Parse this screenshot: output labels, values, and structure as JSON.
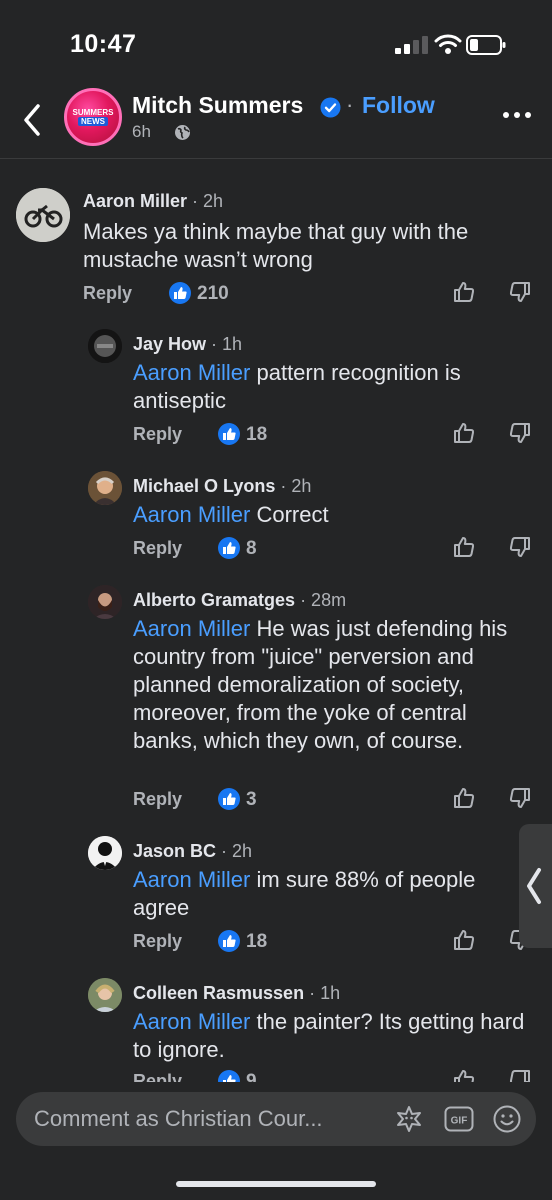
{
  "status_bar": {
    "time": "10:47"
  },
  "header": {
    "page_name": "Mitch Summers",
    "separator": "·",
    "follow_label": "Follow",
    "post_age": "6h",
    "logo_text_top": "SUMMERS",
    "logo_text_bottom": "NEWS"
  },
  "comments": [
    {
      "author": "Aaron Miller",
      "age": "· 2h",
      "mention": "",
      "text": "Makes ya think maybe that guy with the mustache wasn’t wrong",
      "reply_label": "Reply",
      "likes": "210"
    },
    {
      "author": "Jay How",
      "age": "· 1h",
      "mention": "Aaron Miller",
      "text": " pattern recognition is antiseptic",
      "reply_label": "Reply",
      "likes": "18"
    },
    {
      "author": "Michael O Lyons",
      "age": "· 2h",
      "mention": "Aaron Miller",
      "text": " Correct",
      "reply_label": "Reply",
      "likes": "8"
    },
    {
      "author": "Alberto Gramatges",
      "age": "· 28m",
      "mention": "Aaron Miller",
      "text": " He was just defending his country from \"juice\" perversion and planned demoralization of society, moreover, from the yoke of central banks, which they own, of course.",
      "reply_label": "Reply",
      "likes": "3"
    },
    {
      "author": "Jason BC",
      "age": "· 2h",
      "mention": "Aaron Miller",
      "text": " im sure 88% of people agree",
      "reply_label": "Reply",
      "likes": "18"
    },
    {
      "author": "Colleen Rasmussen",
      "age": "· 1h",
      "mention": "Aaron Miller",
      "text": " the painter? Its getting hard to ignore.",
      "reply_label": "Reply",
      "likes": "9"
    }
  ],
  "composer": {
    "placeholder": "Comment as Christian Cour..."
  },
  "icons": {
    "back": "chevron-left-icon",
    "verified": "verified-badge-icon",
    "audience": "globe-icon",
    "more": "more-icon",
    "like_badge": "like-badge-icon",
    "upvote": "thumb-up-icon",
    "downvote": "thumb-down-icon",
    "sticker": "sticker-icon",
    "gif": "gif-icon",
    "emoji": "emoji-icon"
  },
  "colors": {
    "background": "#242526",
    "accent": "#4a9eff",
    "like_blue": "#1877f2"
  }
}
